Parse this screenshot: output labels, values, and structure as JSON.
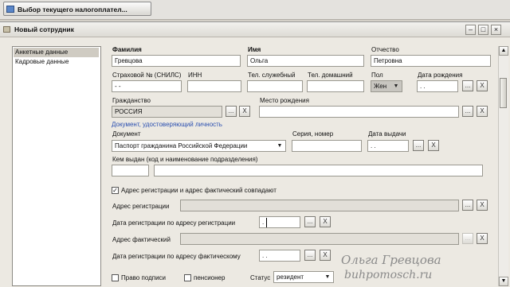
{
  "taskbar": {
    "button_label": "Выбор текущего налогоплател..."
  },
  "window": {
    "title": "Новый сотрудник"
  },
  "sidebar": {
    "items": [
      {
        "label": "Анкетные данные",
        "selected": true
      },
      {
        "label": "Кадровые данные",
        "selected": false
      }
    ]
  },
  "form": {
    "surname": {
      "label": "Фамилия",
      "value": "Гревцова"
    },
    "name": {
      "label": "Имя",
      "value": "Ольга"
    },
    "patronymic": {
      "label": "Отчество",
      "value": "Петровна"
    },
    "snils": {
      "label": "Страховой № (СНИЛС)",
      "value": "-  -"
    },
    "inn": {
      "label": "ИНН",
      "value": ""
    },
    "work_phone": {
      "label": "Тел. служебный",
      "value": ""
    },
    "home_phone": {
      "label": "Тел. домашний",
      "value": ""
    },
    "sex": {
      "label": "Пол",
      "value": "Жен"
    },
    "birth_date": {
      "label": "Дата рождения",
      "value": ". ."
    },
    "citizenship": {
      "label": "Гражданство",
      "value": "РОССИЯ"
    },
    "birth_place": {
      "label": "Место рождения",
      "value": ""
    },
    "id_section": "Документ, удостоверяющий личность",
    "document": {
      "label": "Документ",
      "value": "Паспорт гражданина Российской Федерации"
    },
    "series_number": {
      "label": "Серия, номер",
      "value": ""
    },
    "issue_date": {
      "label": "Дата выдачи",
      "value": ". ."
    },
    "issued_by": {
      "label": "Кем выдан (код и наименование подразделения)",
      "code": "",
      "value": ""
    },
    "same_address": {
      "label": "Адрес регистрации и адрес фактический совпадают",
      "checked": true
    },
    "reg_address": {
      "label": "Адрес регистрации",
      "value": ""
    },
    "reg_date": {
      "label": "Дата регистрации по адресу регистрации",
      "value": ". ."
    },
    "actual_address": {
      "label": "Адрес фактический",
      "value": ""
    },
    "actual_reg_date": {
      "label": "Дата регистрации по адресу фактическому",
      "value": ". ."
    },
    "signature_right": {
      "label": "Право подписи",
      "checked": false
    },
    "pensioner": {
      "label": "пенсионер",
      "checked": false
    },
    "status": {
      "label": "Статус",
      "value": "резидент"
    }
  },
  "buttons": {
    "ellipsis": "...",
    "clear": "X"
  },
  "watermark": {
    "line1": "Ольга Гревцова",
    "line2": "buhpomosch.ru"
  },
  "icons": {
    "window": "form-icon",
    "taskbar": "app-icon"
  }
}
